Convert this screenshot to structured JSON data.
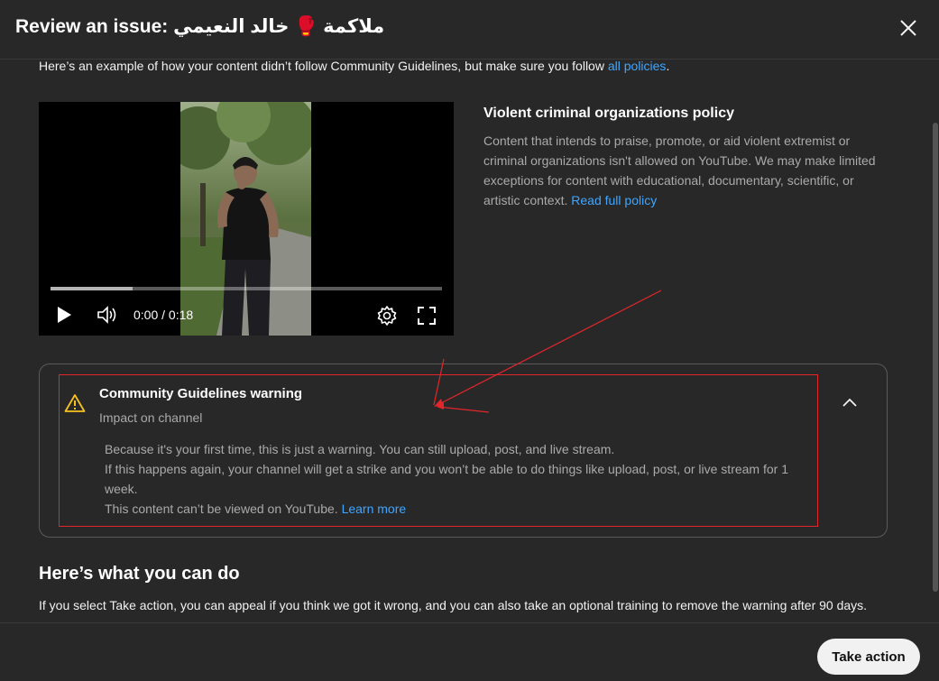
{
  "header": {
    "title": "Review an issue: ملاكمة 🥊 خالد النعيمي",
    "close_icon": "close-icon"
  },
  "intro": {
    "text": "Here’s an example of how your content didn’t follow Community Guidelines, but make sure you follow ",
    "link": "all policies",
    "suffix": "."
  },
  "video": {
    "time": "0:00 / 0:18",
    "progress_buffered": 0.21,
    "icons": [
      "play-icon",
      "volume-icon",
      "settings-icon",
      "fullscreen-icon"
    ]
  },
  "policy": {
    "title": "Violent criminal organizations policy",
    "text": "Content that intends to praise, promote, or aid violent extremist or criminal organizations isn't allowed on YouTube. We may make limited exceptions for content with educational, documentary, scientific, or artistic context. ",
    "link": "Read full policy"
  },
  "warning": {
    "title": "Community Guidelines warning",
    "subtitle": "Impact on channel",
    "line1": "Because it's your first time, this is just a warning. You can still upload, post, and live stream.",
    "line2": "If this happens again, your channel will get a strike and you won’t be able to do things like upload, post, or live stream for 1 week.",
    "line3": "This content can’t be viewed on YouTube. ",
    "link": "Learn more",
    "colors": {
      "icon": "#f9c21f",
      "highlight": "#e3262b"
    }
  },
  "actions": {
    "title": "Here’s what you can do",
    "text": "If you select Take action, you can appeal if you think we got it wrong, and you can also take an optional training to remove the warning after 90 days.",
    "button": "Take action"
  },
  "colors": {
    "background": "#282828",
    "link": "#3ea6ff",
    "muted_text": "#aaaaaa",
    "button_bg": "#f1f1f1"
  }
}
